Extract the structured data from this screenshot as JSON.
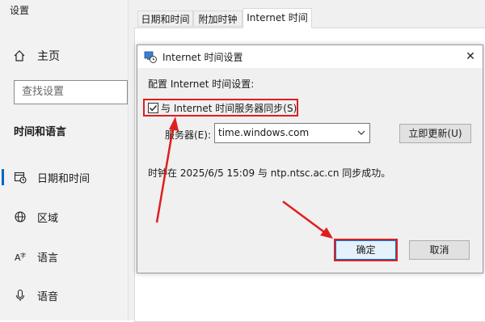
{
  "app": {
    "title": "设置"
  },
  "sidebar": {
    "home_label": "主页",
    "search_placeholder": "查找设置",
    "section_title": "时间和语言",
    "items": [
      {
        "label": "日期和时间",
        "icon": "calendar-clock-icon",
        "active": true
      },
      {
        "label": "区域",
        "icon": "globe-icon",
        "active": false
      },
      {
        "label": "语言",
        "icon": "language-icon",
        "active": false
      },
      {
        "label": "语音",
        "icon": "microphone-icon",
        "active": false
      }
    ]
  },
  "tabs": [
    {
      "label": "日期和时间"
    },
    {
      "label": "附加时钟"
    },
    {
      "label": "Internet 时间",
      "selected": true
    }
  ],
  "dialog": {
    "title": "Internet 时间设置",
    "close_glyph": "✕",
    "heading": "配置 Internet 时间设置:",
    "sync_checkbox": {
      "label": "与 Internet 时间服务器同步(S)",
      "checked": true
    },
    "server_label": "服务器(E):",
    "server_value": "time.windows.com",
    "update_button": "立即更新(U)",
    "status": "时钟在 2025/6/5 15:09 与 ntp.ntsc.ac.cn 同步成功。",
    "ok_button": "确定",
    "cancel_button": "取消"
  },
  "colors": {
    "annotation_red": "#e01e1e",
    "accent_blue": "#0078d7",
    "sidebar_bg": "#f2f2f2",
    "dialog_bg": "#f0f0f0"
  }
}
